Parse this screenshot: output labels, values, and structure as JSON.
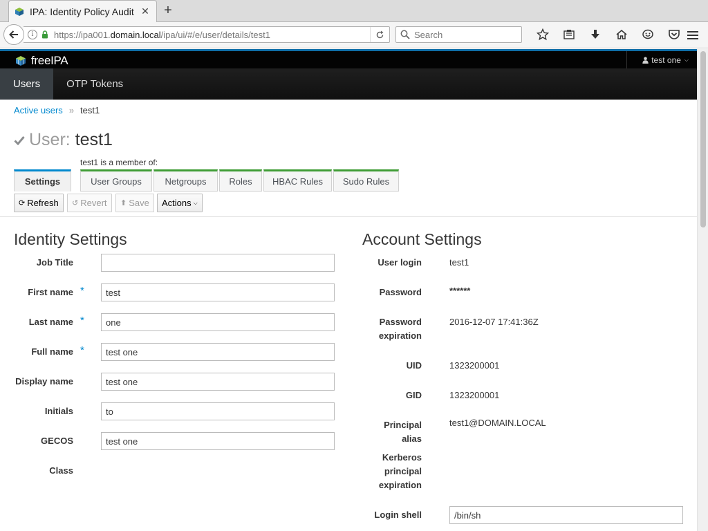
{
  "browser": {
    "tab_title": "IPA: Identity Policy Audit",
    "url_prefix": "https://ipa001.",
    "url_domain": "domain.local",
    "url_suffix": "/ipa/ui/#/e/user/details/test1",
    "search_placeholder": "Search"
  },
  "app": {
    "logo_text": "freeIPA",
    "user_menu": "test one",
    "nav": [
      {
        "label": "Users",
        "active": true
      },
      {
        "label": "OTP Tokens",
        "active": false
      }
    ],
    "breadcrumb": {
      "parent": "Active users",
      "separator": "»",
      "current": "test1"
    },
    "page_title": {
      "kind": "User:",
      "name": "test1"
    },
    "member_of_label": "test1 is a member of:",
    "facet_tabs": [
      "Settings",
      "User Groups",
      "Netgroups",
      "Roles",
      "HBAC Rules",
      "Sudo Rules"
    ],
    "actions": {
      "refresh": "Refresh",
      "revert": "Revert",
      "save": "Save",
      "actions": "Actions"
    },
    "identity": {
      "title": "Identity Settings",
      "fields": [
        {
          "label": "Job Title",
          "value": "",
          "required": false
        },
        {
          "label": "First name",
          "value": "test",
          "required": true
        },
        {
          "label": "Last name",
          "value": "one",
          "required": true
        },
        {
          "label": "Full name",
          "value": "test one",
          "required": true
        },
        {
          "label": "Display name",
          "value": "test one",
          "required": false
        },
        {
          "label": "Initials",
          "value": "to",
          "required": false
        },
        {
          "label": "GECOS",
          "value": "test one",
          "required": false
        },
        {
          "label": "Class",
          "value": "",
          "required": false
        }
      ]
    },
    "account": {
      "title": "Account Settings",
      "fields": [
        {
          "label": "User login",
          "value": "test1"
        },
        {
          "label": "Password",
          "value": "******"
        },
        {
          "label": "Password expiration",
          "value": "2016-12-07 17:41:36Z"
        },
        {
          "label": "UID",
          "value": "1323200001"
        },
        {
          "label": "GID",
          "value": "1323200001"
        },
        {
          "label": "Principal alias",
          "value": "test1@DOMAIN.LOCAL"
        },
        {
          "label": "Kerberos principal expiration",
          "value": ""
        },
        {
          "label": "Login shell",
          "value": "/bin/sh"
        }
      ]
    }
  },
  "colors": {
    "accent": "#0088ce",
    "facet_green": "#3f9c35",
    "topbar": "#030303"
  }
}
